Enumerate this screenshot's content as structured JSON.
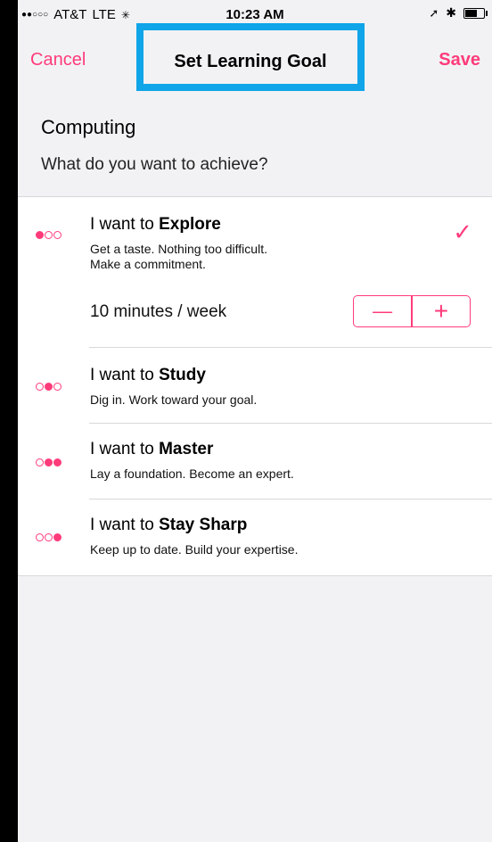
{
  "status_bar": {
    "signal": "●●○○○",
    "carrier": "AT&T",
    "network": "LTE",
    "time": "10:23 AM"
  },
  "nav": {
    "cancel_label": "Cancel",
    "title": "Set Learning Goal",
    "save_label": "Save"
  },
  "header": {
    "subject": "Computing",
    "question": "What do you want to achieve?"
  },
  "goals": [
    {
      "prefix": "I want to",
      "keyword": "Explore",
      "desc1": "Get a taste. Nothing too difficult.",
      "desc2": "Make a commitment.",
      "selected": true,
      "frequency": "10 minutes / week"
    },
    {
      "prefix": "I want to",
      "keyword": "Study",
      "desc1": "Dig in. Work toward your goal."
    },
    {
      "prefix": "I want to",
      "keyword": "Master",
      "desc1": "Lay a foundation. Become an expert."
    },
    {
      "prefix": "I want to",
      "keyword": "Stay Sharp",
      "desc1": "Keep up to date. Build your expertise."
    }
  ],
  "stepper": {
    "minus": "—",
    "plus": "+"
  },
  "icons": {
    "check": "checkmark-icon",
    "dots": "level-dots-icon"
  },
  "colors": {
    "accent": "#ff3b7a",
    "highlight": "#10a5e8"
  }
}
